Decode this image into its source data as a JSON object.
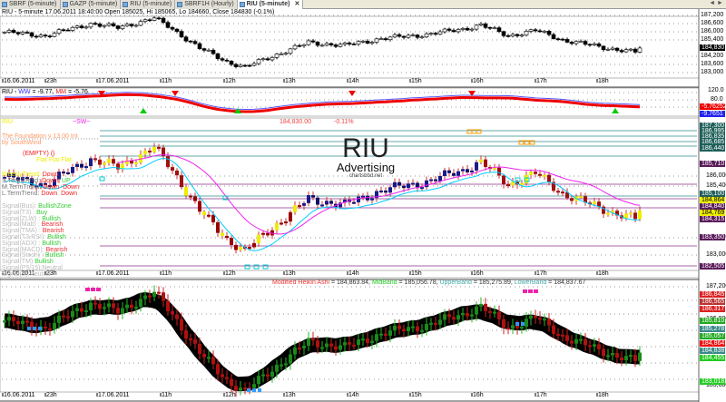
{
  "tabs": [
    {
      "label": "SBRF (5-minute)"
    },
    {
      "label": "GAZP (5-minute)"
    },
    {
      "label": "RIU (5-minute)"
    },
    {
      "label": "SBRF1H (Hourly)"
    },
    {
      "label": "RIU (5-minute)",
      "active": true
    }
  ],
  "nav": "◄ ►",
  "title": "RIU - 5-minute 17.06.2011 18:40:00 Open 185025, Hi 185065, Lo 184660, Close 184830 (-0.1%)",
  "time_ticks": [
    "16.06.2011",
    "23h",
    "17.06.2011",
    "11h",
    "12h",
    "13h",
    "14h",
    "15h",
    "16h",
    "17h",
    "18h"
  ],
  "panel1": {
    "axis": [
      "187,200",
      "186,600",
      "186,000",
      "185,400",
      "184,200",
      "183,600",
      "183,000"
    ],
    "last": "184,830"
  },
  "panel2": {
    "label_prefix": "RIU - ",
    "ww_label": "WW",
    "ww_value": " = -9.77, ",
    "mm_label": "MM",
    "mm_value": " = -5.76",
    "axis": [
      "120.0",
      "80.0"
    ],
    "mm_tag": "-5.76252",
    "ww_tag": "-9.7651"
  },
  "panel3": {
    "top_left": "RIU",
    "sw": "~SW~",
    "price": "184,830.00",
    "change": "-0.11%",
    "foundation": "The Foundation v 13.00 Int",
    "by": "by SouthWind",
    "empty": "(EMPTY) ()",
    "flat": "Flat  Flat  Flat",
    "trends": [
      {
        "k": "WeeklyTrend:",
        "v": "Down",
        "v2": ""
      },
      {
        "k": "S.TermTrend:",
        "v": "Down",
        "v2": "UP"
      },
      {
        "k": "M.TermTrend:",
        "v": "Down",
        "v2": "Down"
      },
      {
        "k": "L.TermTrend:",
        "v": "Down",
        "v2": "Down"
      }
    ],
    "signals": [
      {
        "k": "Signal(Bus):",
        "v": "BullishZone",
        "c": "#3c3"
      },
      {
        "k": "Signal(T3)  :",
        "v": "Buy",
        "c": "#3c3"
      },
      {
        "k": "Signal(ZLW) :",
        "v": "Bullish",
        "c": "#3c3"
      },
      {
        "k": "Signal(Mab) :",
        "v": "Bearish",
        "c": "#e33"
      },
      {
        "k": "Signal(TMA) :",
        "v": "Bearish",
        "c": "#e33"
      },
      {
        "k": "Signal(T3-RSI):",
        "v": "Bullish",
        "c": "#3c3"
      },
      {
        "k": "Signal(ADX) :",
        "v": "Bullish",
        "c": "#3c3"
      },
      {
        "k": "Signal(MACD):",
        "v": "Bearish",
        "c": "#e33"
      },
      {
        "k": "Signal(Stoch) :",
        "v": "Bullish",
        "c": "#3c3"
      },
      {
        "k": "Signal(TM)",
        "v": "Bullish",
        "c": "#3c3"
      },
      {
        "k": "Signal(P5/15):Neutral",
        "v": "",
        "c": "#3c3"
      },
      {
        "k": "Signal(S):Neutral",
        "v": "",
        "c": "#3c3"
      }
    ],
    "watermark": {
      "big": "RIU",
      "mid": "Advertising",
      "small": "chartsbbd.net"
    },
    "axis": [
      "186,000",
      "185,400",
      "183,600",
      "183,000"
    ],
    "tags": [
      {
        "t": "187,300",
        "c": "#1f5f5a"
      },
      {
        "t": "186,995",
        "c": "#1f5f5a"
      },
      {
        "t": "186,835",
        "c": "#1f5f5a"
      },
      {
        "t": "186,685",
        "c": "#1f5f5a"
      },
      {
        "t": "186,440",
        "c": "#1f5f5a"
      },
      {
        "t": "185,710",
        "c": "#5a1a5a"
      },
      {
        "t": "185,100",
        "c": "#1f5f5a"
      },
      {
        "t": "184,864",
        "c": "#ee0",
        "fg": "#000"
      },
      {
        "t": "184,840",
        "c": "#5a1a5a"
      },
      {
        "t": "184,769",
        "c": "#ee0",
        "fg": "#000"
      },
      {
        "t": "184,315",
        "c": "#5a1a5a"
      },
      {
        "t": "183,350",
        "c": "#5a1a5a"
      },
      {
        "t": "182,505",
        "c": "#5a1a5a"
      }
    ]
  },
  "panel4": {
    "ha_label": "Modified Heikin Ashi",
    "ha_value": " = 184,863.84, ",
    "mid_label": "MidBand",
    "mid_value": " = 185,056.78, ",
    "up_label": "UpperBand",
    "up_value": " = 185,275.89, ",
    "low_label": "LowerBand",
    "low_value": " = 184,837.67",
    "axis": [
      "187,200",
      "186,000",
      "183,600"
    ],
    "tags": [
      {
        "t": "186,845",
        "c": "#d22"
      },
      {
        "t": "186,565",
        "c": "#b33"
      },
      {
        "t": "186,317",
        "c": "#d22"
      },
      {
        "t": "185,810",
        "c": "#2a2"
      },
      {
        "t": "185,278",
        "c": "#3a8a8a"
      },
      {
        "t": "185,057",
        "c": "#2a2"
      },
      {
        "t": "184,864",
        "c": "#e11"
      },
      {
        "t": "184,838",
        "c": "#3a8a8a"
      },
      {
        "t": "184,455",
        "c": "#2c2"
      },
      {
        "t": "183,018",
        "c": "#2c2"
      }
    ]
  },
  "chart_data": {
    "type": "candlestick",
    "symbol": "RIU",
    "interval": "5-minute",
    "anchors_x_hours": [
      0,
      50,
      100,
      130,
      170,
      190,
      220,
      250,
      270,
      300,
      340,
      380,
      420,
      470,
      510,
      530,
      560,
      590,
      620,
      660,
      700,
      705
    ],
    "anchors_price": [
      186000,
      185700,
      186600,
      186300,
      187000,
      186200,
      184800,
      183800,
      183400,
      184200,
      185200,
      185000,
      185500,
      185800,
      186200,
      186500,
      185700,
      186100,
      185400,
      184900,
      184500,
      184830
    ],
    "last_close": 184830
  }
}
